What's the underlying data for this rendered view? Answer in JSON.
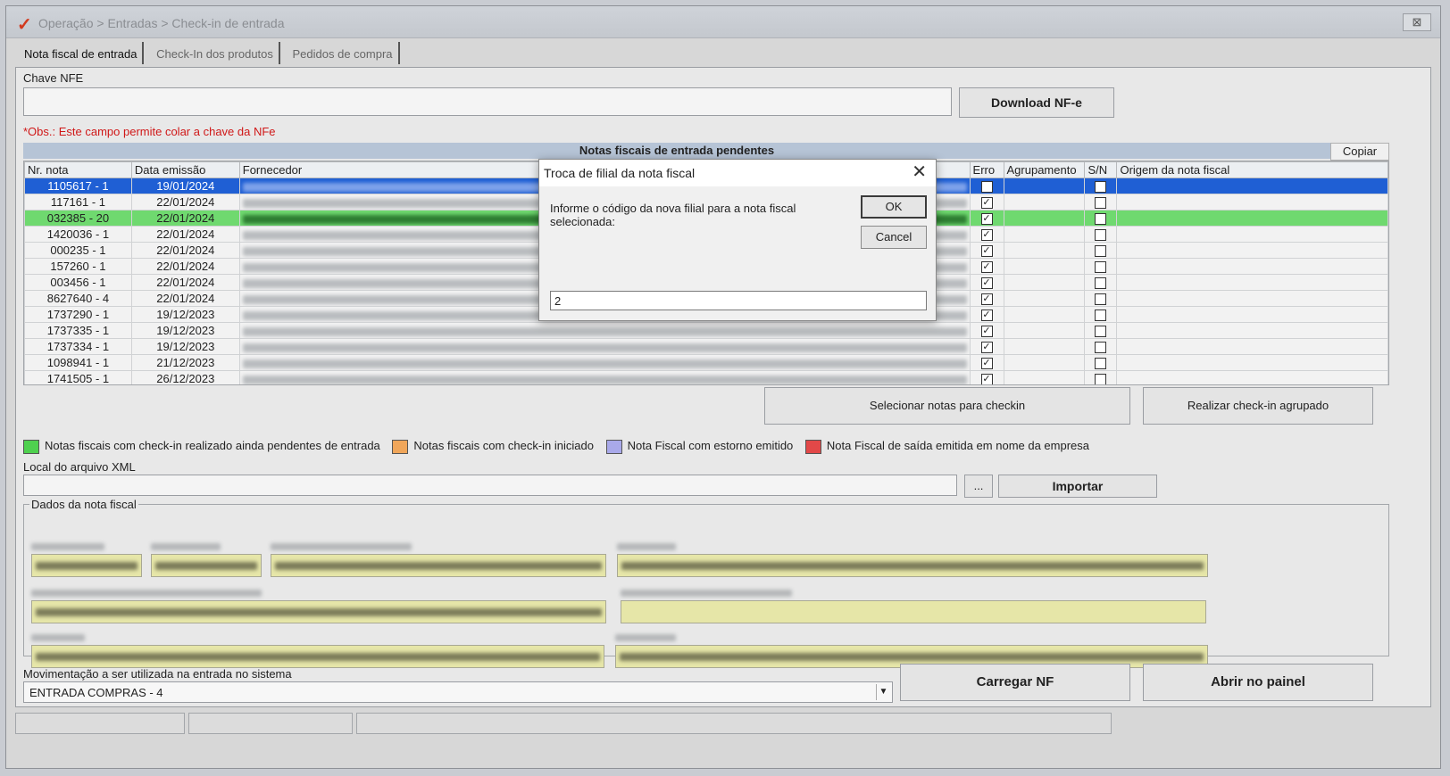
{
  "window": {
    "title": "Operação > Entradas > Check-in de entrada",
    "close_glyph": "⊠"
  },
  "tabs": [
    {
      "label": "Nota fiscal de entrada",
      "active": true
    },
    {
      "label": "Check-In dos produtos",
      "active": false
    },
    {
      "label": "Pedidos de compra",
      "active": false
    }
  ],
  "chave_nfe": {
    "label": "Chave NFE",
    "value": "",
    "download_label": "Download NF-e",
    "obs": "*Obs.: Este campo permite colar a chave da NFe"
  },
  "grid": {
    "title": "Notas fiscais de entrada pendentes",
    "copy_label": "Copiar",
    "columns": [
      "Nr. nota",
      "Data emissão",
      "Fornecedor",
      "Erro",
      "Agrupamento",
      "S/N",
      "Origem da nota fiscal"
    ],
    "rows": [
      {
        "nr": "1105617 - 1",
        "data": "19/01/2024",
        "erro": true,
        "sn": false,
        "state": "selected"
      },
      {
        "nr": "117161 - 1",
        "data": "22/01/2024",
        "erro": true,
        "sn": false,
        "state": ""
      },
      {
        "nr": "032385 - 20",
        "data": "22/01/2024",
        "erro": true,
        "sn": false,
        "state": "green"
      },
      {
        "nr": "1420036 - 1",
        "data": "22/01/2024",
        "erro": true,
        "sn": false,
        "state": ""
      },
      {
        "nr": "000235 - 1",
        "data": "22/01/2024",
        "erro": true,
        "sn": false,
        "state": ""
      },
      {
        "nr": "157260 - 1",
        "data": "22/01/2024",
        "erro": true,
        "sn": false,
        "state": ""
      },
      {
        "nr": "003456 - 1",
        "data": "22/01/2024",
        "erro": true,
        "sn": false,
        "state": ""
      },
      {
        "nr": "8627640 - 4",
        "data": "22/01/2024",
        "erro": true,
        "sn": false,
        "state": ""
      },
      {
        "nr": "1737290 - 1",
        "data": "19/12/2023",
        "erro": true,
        "sn": false,
        "state": ""
      },
      {
        "nr": "1737335 - 1",
        "data": "19/12/2023",
        "erro": true,
        "sn": false,
        "state": ""
      },
      {
        "nr": "1737334 - 1",
        "data": "19/12/2023",
        "erro": true,
        "sn": false,
        "state": ""
      },
      {
        "nr": "1098941 - 1",
        "data": "21/12/2023",
        "erro": true,
        "sn": false,
        "state": ""
      },
      {
        "nr": "1741505 - 1",
        "data": "26/12/2023",
        "erro": true,
        "sn": false,
        "state": ""
      }
    ]
  },
  "actions": {
    "selecionar": "Selecionar notas para checkin",
    "agrupado": "Realizar check-in agrupado"
  },
  "legend": [
    {
      "label": "Notas fiscais com check-in realizado ainda pendentes de entrada",
      "color": "#4fd14f"
    },
    {
      "label": "Notas fiscais com check-in iniciado",
      "color": "#f0a65a"
    },
    {
      "label": "Nota Fiscal com estorno emitido",
      "color": "#a9a9ea"
    },
    {
      "label": "Nota Fiscal de saída emitida em nome da empresa",
      "color": "#e24848"
    }
  ],
  "xml": {
    "label": "Local do arquivo XML",
    "value": "",
    "browse_label": "...",
    "import_label": "Importar"
  },
  "dados": {
    "legend": "Dados da nota fiscal"
  },
  "movimentacao": {
    "label": "Movimentação a ser utilizada na entrada no sistema",
    "selected": "ENTRADA COMPRAS - 4"
  },
  "footer_buttons": {
    "carregar": "Carregar NF",
    "abrir": "Abrir no painel"
  },
  "dialog": {
    "title": "Troca de filial da nota fiscal",
    "close_glyph": "✕",
    "prompt": "Informe o código da nova filial para a nota fiscal selecionada:",
    "ok_label": "OK",
    "cancel_label": "Cancel",
    "input_value": "2"
  },
  "colors": {
    "selected_row": "#1f5fd4",
    "green_row": "#6fd96f",
    "obs_text": "#d01818",
    "yellow_field": "#e6e6a8"
  }
}
